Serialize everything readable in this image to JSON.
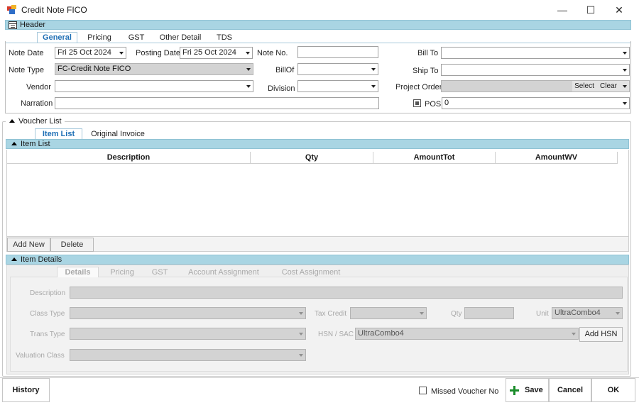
{
  "window": {
    "title": "Credit Note FICO",
    "minimize": "—",
    "maximize": "☐",
    "close": "✕"
  },
  "header": {
    "band_label": "Header",
    "tabs": [
      "General",
      "Pricing",
      "GST",
      "Other Detail",
      "TDS"
    ],
    "note_date_label": "Note Date",
    "note_date_value": "Fri 25 Oct 2024",
    "posting_date_label": "Posting Date",
    "posting_date_value": "Fri 25 Oct 2024",
    "note_no_label": "Note No.",
    "note_no_value": "",
    "bill_to_label": "Bill To",
    "bill_to_value": "",
    "note_type_label": "Note Type",
    "note_type_value": "FC-Credit Note FICO",
    "billof_label": "BillOf",
    "billof_value": "",
    "ship_to_label": "Ship To",
    "ship_to_value": "",
    "vendor_label": "Vendor",
    "vendor_value": "",
    "division_label": "Division",
    "division_value": "",
    "project_order_label": "Project Order",
    "project_order_value": "",
    "select_label": "Select",
    "clear_label": "Clear",
    "narration_label": "Narration",
    "narration_value": "",
    "pos_label": "POS",
    "pos_value": "0"
  },
  "voucher": {
    "label": "Voucher List",
    "tabs": [
      "Item List",
      "Original Invoice"
    ],
    "item_list_band": "Item List",
    "columns": [
      "Description",
      "Qty",
      "AmountTot",
      "AmountWV"
    ],
    "add_new_label": "Add New",
    "delete_label": "Delete"
  },
  "details": {
    "band_label": "Item Details",
    "tabs": [
      "Details",
      "Pricing",
      "GST",
      "Account Assignment",
      "Cost Assignment"
    ],
    "description_label": "Description",
    "class_type_label": "Class Type",
    "tax_credit_label": "Tax Credit",
    "qty_label": "Qty",
    "unit_label": "Unit",
    "unit_value": "UltraCombo4",
    "trans_type_label": "Trans Type",
    "hsn_label": "HSN / SAC",
    "hsn_value": "UltraCombo4",
    "add_hsn_label": "Add HSN",
    "valuation_class_label": "Valuation Class"
  },
  "footer": {
    "history_label": "History",
    "missed_voucher_label": "Missed Voucher No",
    "save_label": "Save",
    "cancel_label": "Cancel",
    "ok_label": "OK"
  },
  "colors": {
    "band": "#a9d5e3",
    "active_tab": "#1e6fb5",
    "save_plus": "#1a8c2a",
    "disabled_field": "#d3d3d3"
  }
}
